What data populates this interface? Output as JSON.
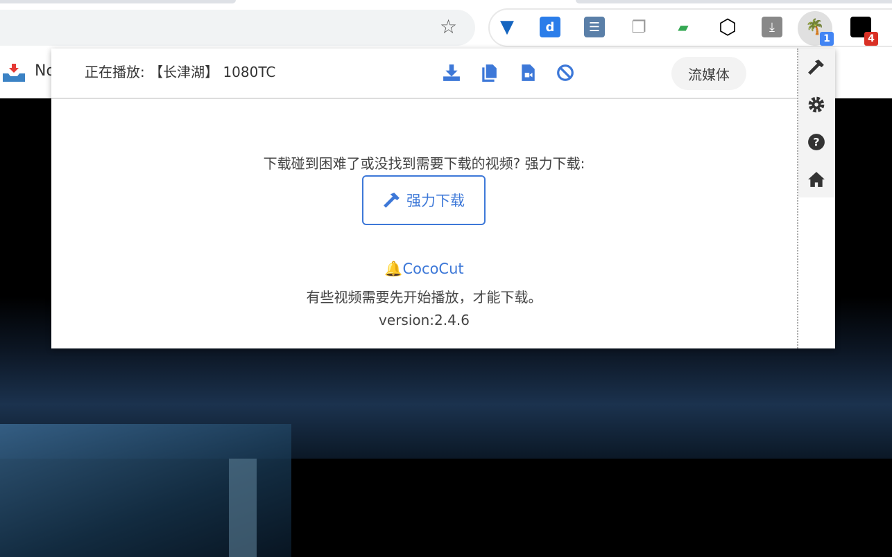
{
  "browser": {
    "bookmark_text": "No",
    "extensions": [
      {
        "name": "funnel-extension",
        "color": "#1565c0"
      },
      {
        "name": "d-extension",
        "color": "#2b7de9"
      },
      {
        "name": "list-extension",
        "color": "#5a7fa8"
      },
      {
        "name": "copy-extension",
        "color": "#999999"
      },
      {
        "name": "chat-extension",
        "color": "#34a853"
      },
      {
        "name": "hexagon-extension",
        "color": "#000000"
      },
      {
        "name": "download-extension",
        "color": "#777777"
      },
      {
        "name": "cococut-extension",
        "color": "#2e7d6b",
        "badge": "1",
        "badge_color": "#4285f4"
      },
      {
        "name": "dark-extension",
        "color": "#000000",
        "badge": "4",
        "badge_color": "#d93025"
      }
    ]
  },
  "popup": {
    "now_playing": "正在播放: 【长津湖】 1080TC",
    "stream_button": "流媒体",
    "hint": "下载碰到困难了或没找到需要下载的视频? 强力下载:",
    "force_download": "强力下载",
    "brand": "CocoCut",
    "note": "有些视频需要先开始播放，才能下载。",
    "version": "version:2.4.6",
    "accent": "#3d78d8"
  }
}
